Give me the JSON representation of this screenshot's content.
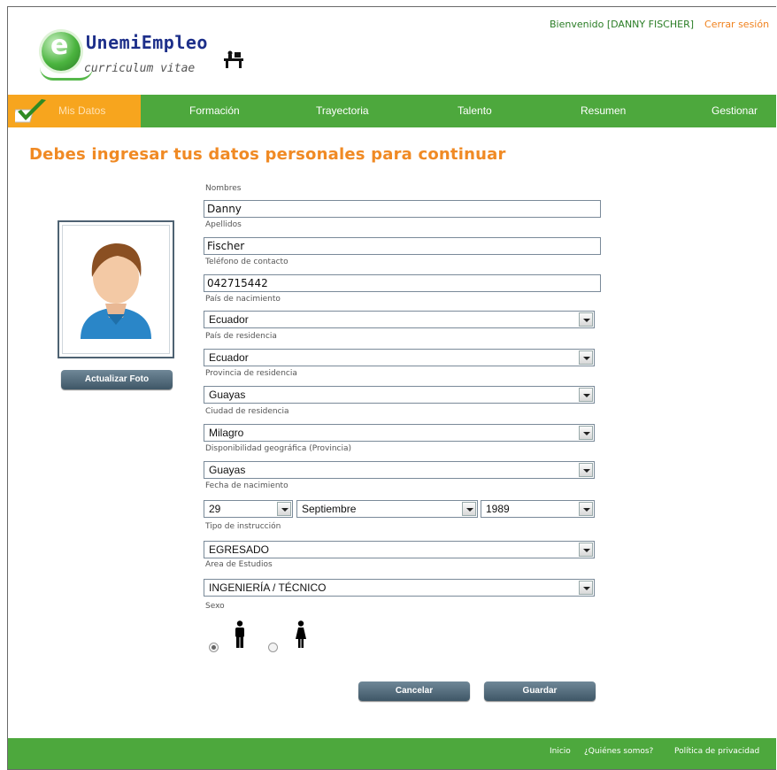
{
  "header": {
    "logo_title": "UnemiEmpleo",
    "logo_letter": "e",
    "logo_subtitle": "curriculum vitae",
    "welcome": "Bienvenido [DANNY FISCHER]",
    "logout": "Cerrar sesión"
  },
  "nav": {
    "items": [
      {
        "label": "Mis Datos",
        "active": true
      },
      {
        "label": "Formación"
      },
      {
        "label": "Trayectoria"
      },
      {
        "label": "Talento"
      },
      {
        "label": "Resumen"
      },
      {
        "label": "Gestionar"
      }
    ]
  },
  "page": {
    "title": "Debes ingresar tus datos personales para continuar"
  },
  "photo": {
    "update_button": "Actualizar Foto"
  },
  "form": {
    "nombres_label": "Nombres",
    "nombres_value": "Danny",
    "apellidos_label": "Apellidos",
    "apellidos_value": "Fischer",
    "telefono_label": "Teléfono de contacto",
    "telefono_value": "042715442",
    "pais_nac_label": "País de nacimiento",
    "pais_nac_value": "Ecuador",
    "pais_res_label": "País de residencia",
    "pais_res_value": "Ecuador",
    "provincia_label": "Provincia de residencia",
    "provincia_value": "Guayas",
    "ciudad_label": "Ciudad de residencia",
    "ciudad_value": "Milagro",
    "disp_label": "Disponibilidad geográfica (Provincia)",
    "disp_value": "Guayas",
    "fecha_label": "Fecha de nacimiento",
    "fecha_dia": "29",
    "fecha_mes": "Septiembre",
    "fecha_anio": "1989",
    "instruccion_label": "Tipo de instrucción",
    "instruccion_value": "EGRESADO",
    "area_label": "Area de Estudios",
    "area_value": "INGENIERÍA / TÉCNICO",
    "sexo_label": "Sexo",
    "sexo_selected": "masculino",
    "cancel_button": "Cancelar",
    "save_button": "Guardar"
  },
  "footer": {
    "links": [
      "Inicio",
      "¿Quiénes somos?",
      "Política de privacidad"
    ]
  },
  "colors": {
    "green": "#4da83d",
    "orange": "#f7a51e",
    "title_orange": "#f08a24",
    "button": "#4e6272"
  }
}
